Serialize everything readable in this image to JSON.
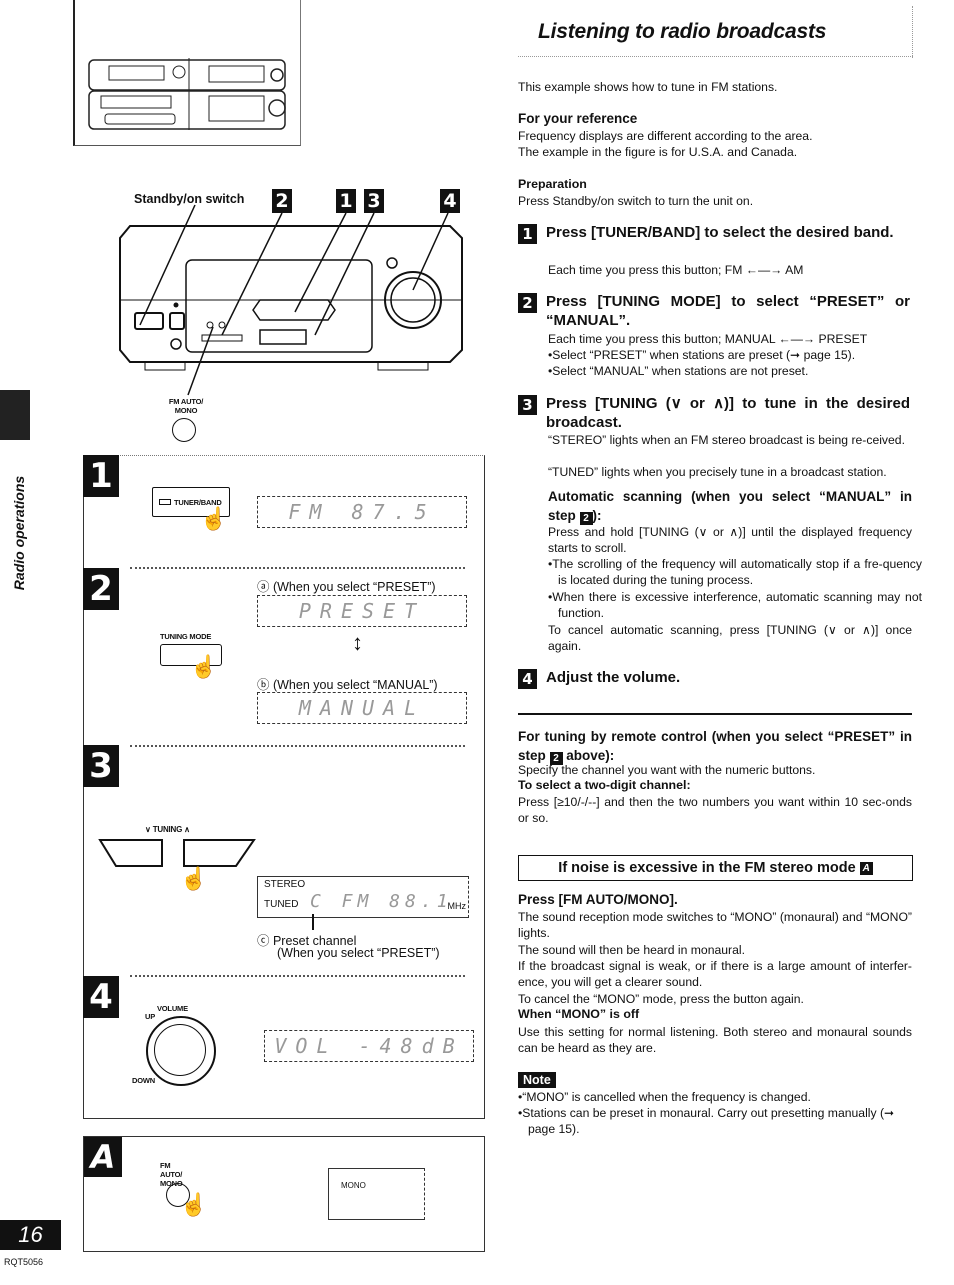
{
  "page": {
    "title": "Listening to radio broadcasts",
    "section_tab": "Radio operations",
    "page_number": "16",
    "doc_code": "RQT5056"
  },
  "intro": {
    "text": "This example shows how to tune in FM stations.",
    "reference_heading": "For your reference",
    "reference_lines": [
      "Frequency displays are different according to the area.",
      "The example in the figure is for U.S.A. and Canada."
    ],
    "preparation_heading": "Preparation",
    "preparation_text": "Press Standby/on switch to turn the unit on."
  },
  "steps": [
    {
      "number": "1",
      "title": "Press [TUNER/BAND] to select the desired band.",
      "body": [
        "Each time you press this button; FM ←—→ AM"
      ]
    },
    {
      "number": "2",
      "title": "Press [TUNING MODE] to select “PRESET” or “MANUAL”.",
      "body": [
        "Each time you press this button; MANUAL ←—→ PRESET"
      ],
      "bullets": [
        "Select “PRESET” when stations are preset (➞ page 15).",
        "Select “MANUAL” when stations are not preset."
      ]
    },
    {
      "number": "3",
      "title": "Press [TUNING (∨ or ∧)] to tune in the desired broadcast.",
      "body": [
        "“STEREO” lights when an FM stereo broadcast is being re-ceived.",
        "“TUNED” lights when you precisely tune in a broadcast station."
      ]
    },
    {
      "number": "4",
      "title": "Adjust the volume."
    }
  ],
  "auto_scan": {
    "heading_pre": "Automatic scanning (when you select “MANUAL” in step ",
    "heading_ref": "2",
    "heading_post": "):",
    "body": "Press and hold [TUNING (∨ or ∧)] until the displayed frequency starts to scroll.",
    "bullets": [
      "The scrolling of the frequency will automatically stop if a fre-quency is located during the tuning process.",
      "When there is excessive interference, automatic scanning may not function."
    ],
    "cancel": "To cancel automatic scanning, press [TUNING (∨ or ∧)] once again."
  },
  "remote": {
    "heading_pre": "For tuning by remote control (when you select “PRESET” in step ",
    "heading_ref": "2",
    "heading_post": " above):",
    "body": "Specify the channel you want with the numeric buttons.",
    "sub_heading": "To select a two-digit channel:",
    "sub_body": "Press [≥10/-/--] and then the two numbers you want within 10 sec-onds or so."
  },
  "noise": {
    "box_title": "If noise is excessive in the FM stereo mode",
    "box_ref": "A",
    "heading": "Press [FM AUTO/MONO].",
    "lines": [
      "The sound reception mode switches to “MONO” (monaural) and “MONO” lights.",
      "The sound will then be heard in monaural.",
      "If the broadcast signal is weak, or if there is a large amount of interfer-ence, you will get a clearer sound.",
      "To cancel the “MONO” mode, press the button again."
    ],
    "off_heading": "When “MONO” is off",
    "off_body": "Use this setting for normal listening. Both stereo and monaural sounds can be heard as they are."
  },
  "note": {
    "label": "Note",
    "bullets": [
      "“MONO” is cancelled when the frequency is changed.",
      "Stations can be preset in monaural. Carry out presetting manually (➞ page 15)."
    ]
  },
  "figure": {
    "standby_label": "Standby/on switch",
    "callouts": [
      "2",
      "1",
      "3",
      "4"
    ],
    "fm_auto_mono_label": "FM AUTO/ MONO",
    "panel1": {
      "button_label": "TUNER/BAND",
      "display": "FM 87.5"
    },
    "panel2": {
      "button_label": "TUNING MODE",
      "caption_a": "ⓐ (When you select “PRESET”)",
      "display_a": "PRESET",
      "caption_b": "ⓑ (When you select “MANUAL”)",
      "display_b": "MANUAL"
    },
    "panel3": {
      "button_label": "TUNING",
      "stereo": "STEREO",
      "tuned": "TUNED",
      "display": "C FM 88.1",
      "unit": "MHz",
      "caption_c": "ⓒ Preset channel",
      "caption_c2": "(When you select “PRESET”)"
    },
    "panel4": {
      "knob_label": "VOLUME",
      "up": "UP",
      "down": "DOWN",
      "display": "VOL -48dB"
    },
    "panelA": {
      "letter": "A",
      "button_label": "FM AUTO/ MONO",
      "display": "MONO"
    }
  }
}
